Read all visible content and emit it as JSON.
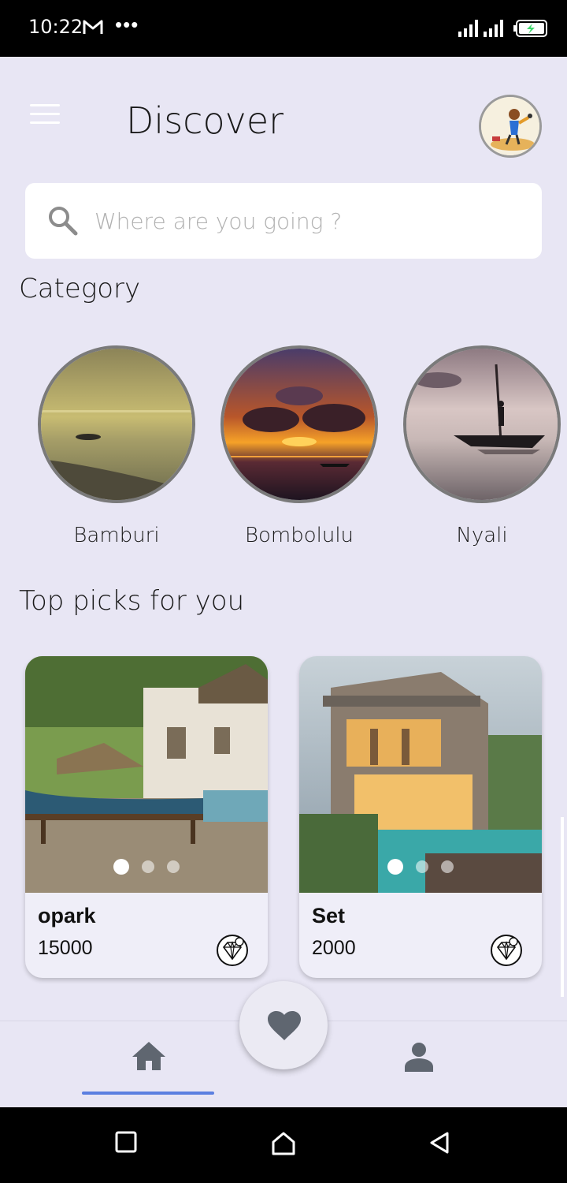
{
  "status_bar": {
    "time": "10:22",
    "more": "•••",
    "icons": [
      "gmail-icon",
      "signal-icon",
      "signal-icon",
      "battery-charging-icon"
    ]
  },
  "header": {
    "title": "Discover",
    "menu_icon": "menu-icon",
    "avatar_icon": "avatar"
  },
  "search": {
    "placeholder": "Where are you going ?",
    "value": "",
    "icon": "search-icon"
  },
  "category": {
    "title": "Category",
    "items": [
      {
        "label": "Bamburi"
      },
      {
        "label": "Bombolulu"
      },
      {
        "label": "Nyali"
      }
    ]
  },
  "top_picks": {
    "title": "Top picks for you",
    "items": [
      {
        "name": "opark",
        "price": "15000",
        "image_count": 3,
        "active_image": 1,
        "badge_icon": "diamond-icon"
      },
      {
        "name": "Set",
        "price": "2000",
        "image_count": 3,
        "active_image": 1,
        "badge_icon": "diamond-icon"
      }
    ]
  },
  "bottom_nav": {
    "items": [
      "home-icon",
      "heart-icon",
      "person-icon"
    ],
    "active": "home-icon"
  },
  "system_nav": {
    "items": [
      "square-icon",
      "home-outline-icon",
      "back-icon"
    ]
  },
  "colors": {
    "background": "#e8e6f4",
    "accent": "#5b7fe0",
    "nav_icon": "#5f6670"
  }
}
